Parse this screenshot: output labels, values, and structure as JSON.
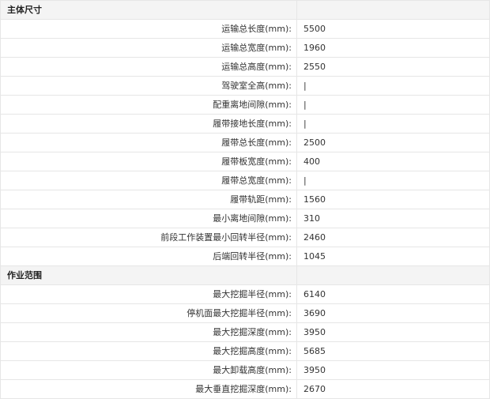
{
  "sections": [
    {
      "title": "主体尺寸",
      "rows": [
        {
          "label": "运输总长度(mm):",
          "value": "5500"
        },
        {
          "label": "运输总宽度(mm):",
          "value": "1960"
        },
        {
          "label": "运输总高度(mm):",
          "value": "2550"
        },
        {
          "label": "驾驶室全高(mm):",
          "value": "|"
        },
        {
          "label": "配重离地间隙(mm):",
          "value": "|"
        },
        {
          "label": "履带接地长度(mm):",
          "value": "|"
        },
        {
          "label": "履带总长度(mm):",
          "value": "2500"
        },
        {
          "label": "履带板宽度(mm):",
          "value": "400"
        },
        {
          "label": "履带总宽度(mm):",
          "value": "|"
        },
        {
          "label": "履带轨距(mm):",
          "value": "1560"
        },
        {
          "label": "最小离地间隙(mm):",
          "value": "310"
        },
        {
          "label": "前段工作装置最小回转半径(mm):",
          "value": "2460"
        },
        {
          "label": "后端回转半径(mm):",
          "value": "1045"
        }
      ]
    },
    {
      "title": "作业范围",
      "rows": [
        {
          "label": "最大挖掘半径(mm):",
          "value": "6140"
        },
        {
          "label": "停机面最大挖掘半径(mm):",
          "value": "3690"
        },
        {
          "label": "最大挖掘深度(mm):",
          "value": "3950"
        },
        {
          "label": "最大挖掘高度(mm):",
          "value": "5685"
        },
        {
          "label": "最大卸载高度(mm):",
          "value": "3950"
        },
        {
          "label": "最大垂直挖掘深度(mm):",
          "value": "2670"
        }
      ]
    }
  ]
}
